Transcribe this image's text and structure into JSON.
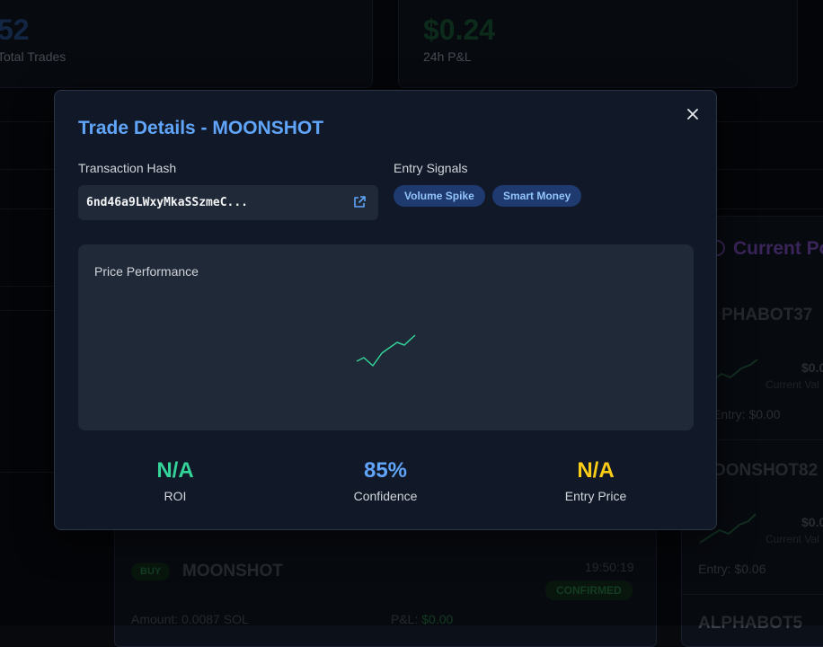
{
  "background": {
    "stats": [
      {
        "value": "52",
        "label": "Total Trades"
      },
      {
        "value": "$0.24",
        "label": "24h P&L"
      }
    ],
    "positions": {
      "title": "Current Po",
      "items": [
        {
          "name": "PHABOT37",
          "value": "$0.0",
          "sub": "Current Val",
          "entry": "Entry: $0.00"
        },
        {
          "name": "OONSHOT82",
          "value": "$0.0",
          "sub": "Current Val",
          "entry": "Entry: $0.06"
        },
        {
          "name": "ALPHABOT5"
        }
      ]
    },
    "trade": {
      "side": "BUY",
      "token": "MOONSHOT",
      "time": "19:50:19",
      "status": "CONFIRMED",
      "amount": "Amount: 0.0087 SOL",
      "pnl_label": "P&L: ",
      "pnl_value": "$0.00"
    }
  },
  "modal": {
    "title": "Trade Details - MOONSHOT",
    "hash_label": "Transaction Hash",
    "hash_value": "6nd46a9LWxyMkaSSzmeC...",
    "signals_label": "Entry Signals",
    "signals": [
      "Volume Spike",
      "Smart Money"
    ],
    "chart_title": "Price Performance",
    "metrics": [
      {
        "value": "N/A",
        "label": "ROI",
        "color": "#34d399"
      },
      {
        "value": "85%",
        "label": "Confidence",
        "color": "#60a5fa"
      },
      {
        "value": "N/A",
        "label": "Entry Price",
        "color": "#facc15"
      }
    ]
  },
  "colors": {
    "accent": "#60a5fa",
    "positive": "#34d399",
    "warning": "#facc15",
    "badge_bg": "#1e3a6e"
  },
  "icons": [
    "close-icon",
    "external-link-icon",
    "sparkline-icon"
  ]
}
